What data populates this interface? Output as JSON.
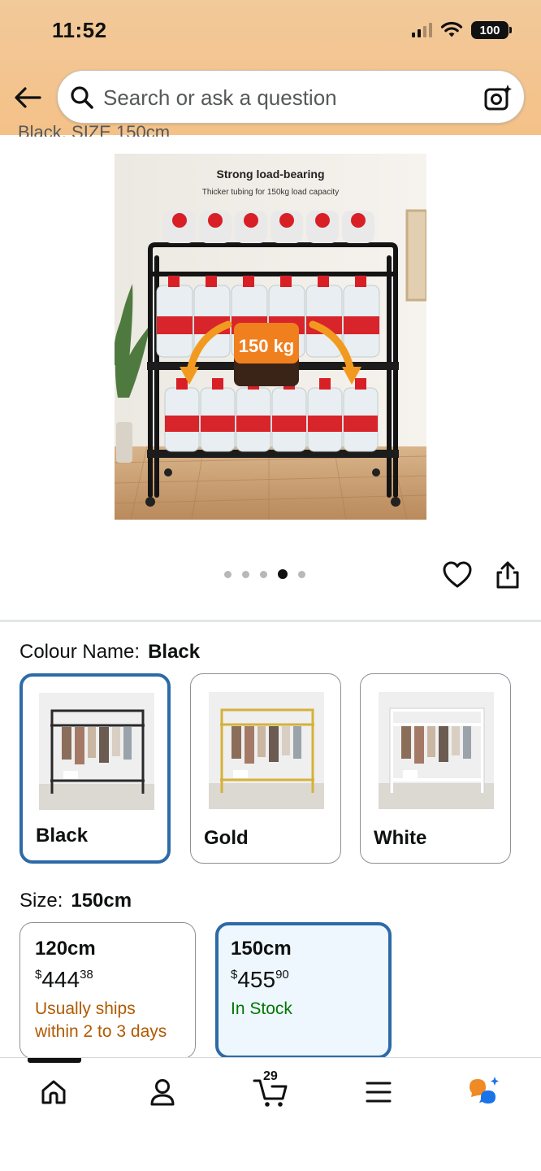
{
  "status_bar": {
    "time": "11:52",
    "battery": "100"
  },
  "header": {
    "search_placeholder": "Search or ask a question"
  },
  "cut_off_text": "Black, SIZE 150cm",
  "product_image": {
    "heading": "Strong load-bearing",
    "subheading": "Thicker tubing for 150kg load capacity",
    "badge": "150 kg"
  },
  "carousel": {
    "total": 5,
    "active_index": 3
  },
  "colour": {
    "label": "Colour Name:",
    "selected": "Black",
    "options": [
      {
        "name": "Black",
        "frame_color": "#2a2a2a"
      },
      {
        "name": "Gold",
        "frame_color": "#d4b23a"
      },
      {
        "name": "White",
        "frame_color": "#f4f4f4"
      }
    ]
  },
  "size": {
    "label": "Size:",
    "selected": "150cm",
    "options": [
      {
        "size": "120cm",
        "currency": "$",
        "price_whole": "444",
        "price_fraction": "38",
        "availability_line1": "Usually ships",
        "availability_line2": "within 2 to 3 days"
      },
      {
        "size": "150cm",
        "currency": "$",
        "price_whole": "455",
        "price_fraction": "90",
        "availability_line1": "In Stock",
        "availability_line2": ""
      }
    ]
  },
  "bottom_nav": {
    "cart_count": "29"
  },
  "colors": {
    "accent_blue": "#2d6aa7",
    "header_bg": "#f4c188",
    "in_stock": "#007600",
    "ships_later": "#b05a00"
  }
}
